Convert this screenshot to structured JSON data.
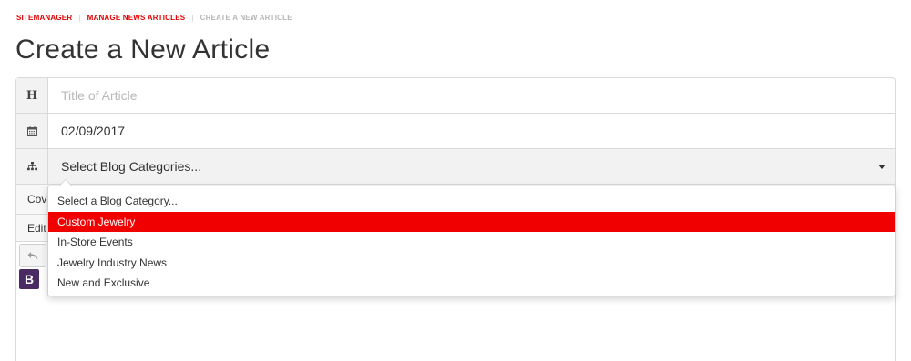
{
  "breadcrumb": {
    "items": [
      "SITEMANAGER",
      "MANAGE NEWS ARTICLES"
    ],
    "separator": "|",
    "current": "CREATE A NEW ARTICLE"
  },
  "page": {
    "title": "Create a New Article"
  },
  "form": {
    "title_addon": "H",
    "title_placeholder": "Title of Article",
    "date_value": "02/09/2017",
    "category_select_label": "Select Blog Categories...",
    "cover_label_partial": "Cove",
    "edit_label_partial": "Edit",
    "bold_label": "B"
  },
  "dropdown": {
    "options": [
      "Select a Blog Category...",
      "Custom Jewelry",
      "In-Store Events",
      "Jewelry Industry News",
      "New and Exclusive"
    ],
    "highlighted": "Custom Jewelry"
  },
  "icons": {
    "title": "heading-icon",
    "date": "calendar-icon",
    "category": "sitemap-icon",
    "undo": "undo-icon"
  },
  "colors": {
    "accent": "#e10000",
    "highlight": "#f00000",
    "bold_button": "#4a2a63"
  }
}
